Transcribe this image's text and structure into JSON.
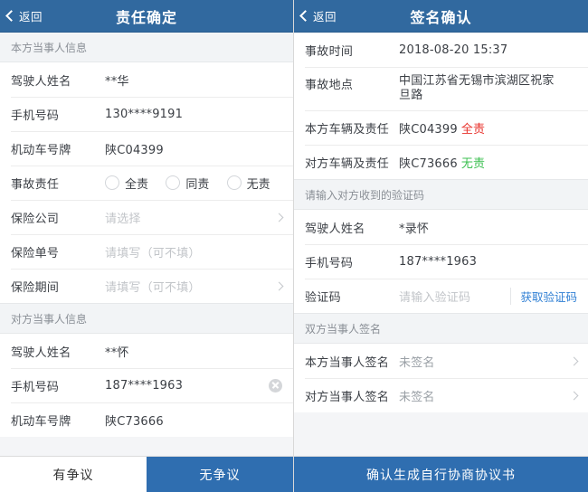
{
  "left_screen": {
    "navbar": {
      "back_label": "返回",
      "title": "责任确定",
      "back_icon": "chevron-left-icon"
    },
    "sections": [
      {
        "header": "本方当事人信息",
        "rows": [
          {
            "label": "驾驶人姓名",
            "value": "**华",
            "type": "text"
          },
          {
            "label": "手机号码",
            "value": "130****9191",
            "type": "text"
          },
          {
            "label": "机动车号牌",
            "value": "陕C04399",
            "type": "text"
          },
          {
            "label": "事故责任",
            "type": "radio",
            "options": [
              "全责",
              "同责",
              "无责"
            ],
            "selected": ""
          },
          {
            "label": "保险公司",
            "value": "请选择",
            "type": "select",
            "placeholder": true,
            "chevron": true
          },
          {
            "label": "保险单号",
            "value": "请填写（可不填）",
            "type": "input",
            "placeholder": true,
            "chevron": false
          },
          {
            "label": "保险期间",
            "value": "请填写（可不填）",
            "type": "select",
            "placeholder": true,
            "chevron": true
          }
        ]
      },
      {
        "header": "对方当事人信息",
        "rows": [
          {
            "label": "驾驶人姓名",
            "value": "**怀",
            "type": "text"
          },
          {
            "label": "手机号码",
            "value": "187****1963",
            "type": "input",
            "clear_icon": "clear-circle-icon"
          },
          {
            "label": "机动车号牌",
            "value": "陕C73666",
            "type": "text"
          }
        ]
      }
    ],
    "bottom_bar": {
      "buttons": [
        {
          "label": "有争议",
          "style": "plain"
        },
        {
          "label": "无争议",
          "style": "primary"
        }
      ]
    }
  },
  "right_screen": {
    "navbar": {
      "back_label": "返回",
      "title": "签名确认",
      "back_icon": "chevron-left-icon"
    },
    "info_rows": [
      {
        "label": "事故时间",
        "value": "2018-08-20 15:37"
      },
      {
        "label": "事故地点",
        "value": "中国江苏省无锡市滨湖区祝家旦路",
        "multiline": true
      }
    ],
    "liability_rows": [
      {
        "label": "本方车辆及责任",
        "plate": "陕C04399",
        "tag": "全责",
        "tag_color": "#e8322c"
      },
      {
        "label": "对方车辆及责任",
        "plate": "陕C73666",
        "tag": "无责",
        "tag_color": "#3cc051"
      }
    ],
    "code_section": {
      "header": "请输入对方收到的验证码",
      "rows": [
        {
          "label": "驾驶人姓名",
          "value": "*录怀"
        },
        {
          "label": "手机号码",
          "value": "187****1963"
        }
      ],
      "code_row": {
        "label": "验证码",
        "placeholder": "请输入验证码",
        "action_label": "获取验证码"
      }
    },
    "signature_section": {
      "header": "双方当事人签名",
      "rows": [
        {
          "label": "本方当事人签名",
          "value": "未签名",
          "chevron": true
        },
        {
          "label": "对方当事人签名",
          "value": "未签名",
          "chevron": true
        }
      ]
    },
    "bottom_bar": {
      "buttons": [
        {
          "label": "确认生成自行协商协议书",
          "style": "primary"
        }
      ]
    }
  }
}
